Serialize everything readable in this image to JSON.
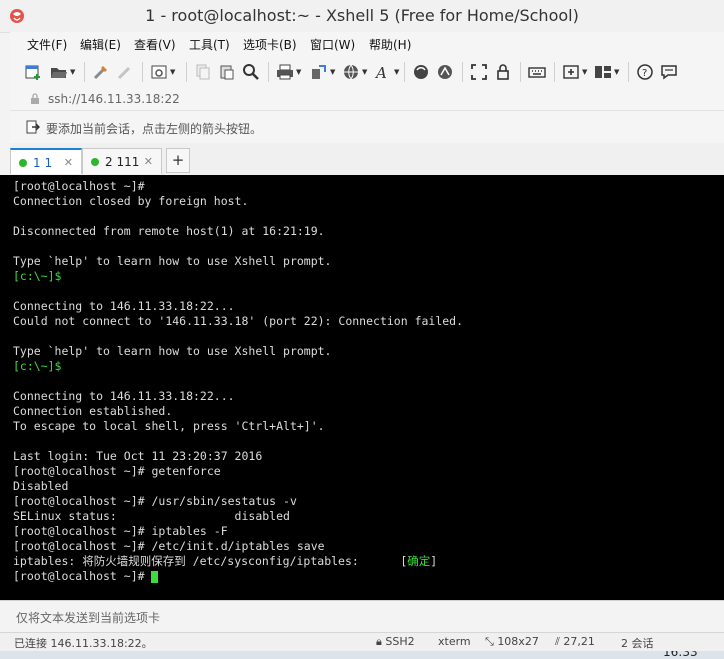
{
  "window": {
    "title": "1 - root@localhost:~ - Xshell 5 (Free for Home/School)"
  },
  "menu": {
    "items": [
      "文件(F)",
      "编辑(E)",
      "查看(V)",
      "工具(T)",
      "选项卡(B)",
      "窗口(W)",
      "帮助(H)"
    ]
  },
  "toolbar": {
    "icons": [
      "new-session-icon",
      "open-folder-icon",
      "reconnect-icon",
      "disconnect-icon",
      "properties-icon",
      "copy-icon",
      "paste-icon",
      "find-icon",
      "print-icon",
      "transfer-icon",
      "encoding-icon",
      "font-icon",
      "xftp-icon",
      "xmanager-icon",
      "fullscreen-icon",
      "lock-icon",
      "keyboard-icon",
      "compose-add-icon",
      "layout-icon",
      "help-icon",
      "chat-icon"
    ]
  },
  "address": {
    "text": "ssh://146.11.33.18:22"
  },
  "hint": {
    "text": "要添加当前会话，点击左侧的箭头按钮。"
  },
  "tabs": [
    {
      "label": "1 1",
      "active": true,
      "status_color": "#2db52d"
    },
    {
      "label": "2 111",
      "active": false,
      "status_color": "#2db52d"
    }
  ],
  "terminal": {
    "lines": [
      "[root@localhost ~]#",
      "Connection closed by foreign host.",
      "",
      "Disconnected from remote host(1) at 16:21:19.",
      "",
      "Type `help' to learn how to use Xshell prompt.",
      "[c:\\~]$",
      "",
      "Connecting to 146.11.33.18:22...",
      "Could not connect to '146.11.33.18' (port 22): Connection failed.",
      "",
      "Type `help' to learn how to use Xshell prompt.",
      "[c:\\~]$",
      "",
      "Connecting to 146.11.33.18:22...",
      "Connection established.",
      "To escape to local shell, press 'Ctrl+Alt+]'.",
      "",
      "Last login: Tue Oct 11 23:20:37 2016",
      "[root@localhost ~]# getenforce",
      "Disabled",
      "[root@localhost ~]# /usr/sbin/sestatus -v",
      "SELinux status:                 disabled",
      "[root@localhost ~]# iptables -F",
      "[root@localhost ~]# /etc/init.d/iptables save",
      "iptables: 将防火墙规则保存到 /etc/sysconfig/iptables:      [",
      "[root@localhost ~]# "
    ],
    "ok_label": "确定",
    "ok_close": "]",
    "colors": {
      "background": "#000000",
      "text": "#dcdcdc",
      "prompt_green": "#3ddc3d"
    }
  },
  "compose": {
    "placeholder": "仅将文本发送到当前选项卡"
  },
  "status": {
    "connection": "已连接 146.11.33.18:22。",
    "protocol": "SSH2",
    "terminal_type": "xterm",
    "size": "108x27",
    "cursor_pos": "27,21",
    "sessions": "2 会话"
  },
  "taskbar": {
    "time": "16:33"
  }
}
